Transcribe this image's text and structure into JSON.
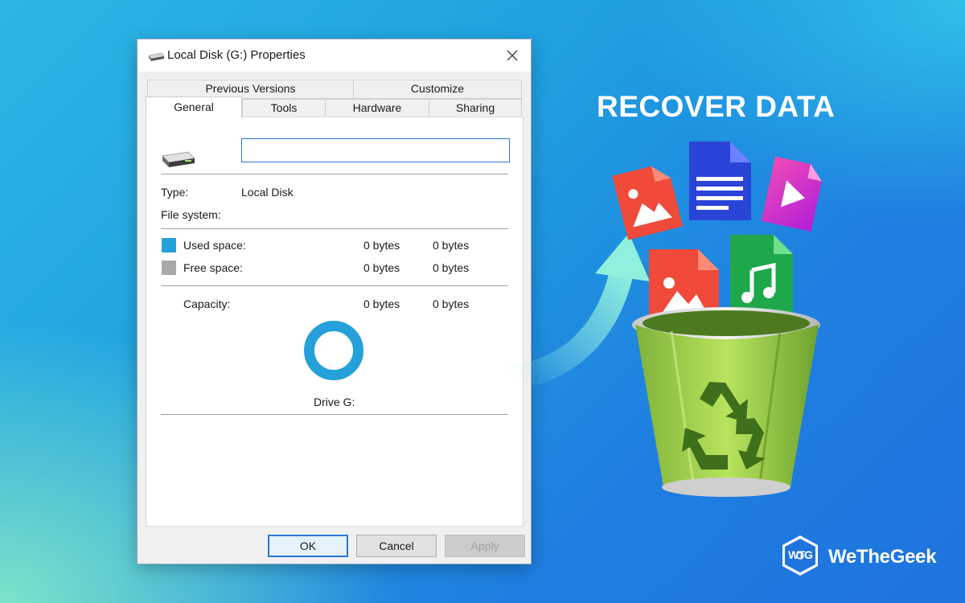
{
  "window": {
    "title": "Local Disk (G:) Properties"
  },
  "tabs": {
    "previous_versions": "Previous Versions",
    "customize": "Customize",
    "general": "General",
    "tools": "Tools",
    "hardware": "Hardware",
    "sharing": "Sharing"
  },
  "general": {
    "name_value": "",
    "type_label": "Type:",
    "type_value": "Local Disk",
    "filesystem_label": "File system:",
    "filesystem_value": "",
    "used_label": "Used space:",
    "used_bytes": "0 bytes",
    "used_size": "0 bytes",
    "free_label": "Free space:",
    "free_bytes": "0 bytes",
    "free_size": "0 bytes",
    "capacity_label": "Capacity:",
    "capacity_bytes": "0 bytes",
    "capacity_size": "0 bytes",
    "drive_label": "Drive G:"
  },
  "colors": {
    "used_space": "#26a0da",
    "free_space": "#a8a8a8",
    "accent": "#2a78d4"
  },
  "buttons": {
    "ok": "OK",
    "cancel": "Cancel",
    "apply": "Apply"
  },
  "promo": {
    "headline": "RECOVER DATA",
    "brand_name": "WeTheGeek",
    "brand_logo": "WTG"
  }
}
